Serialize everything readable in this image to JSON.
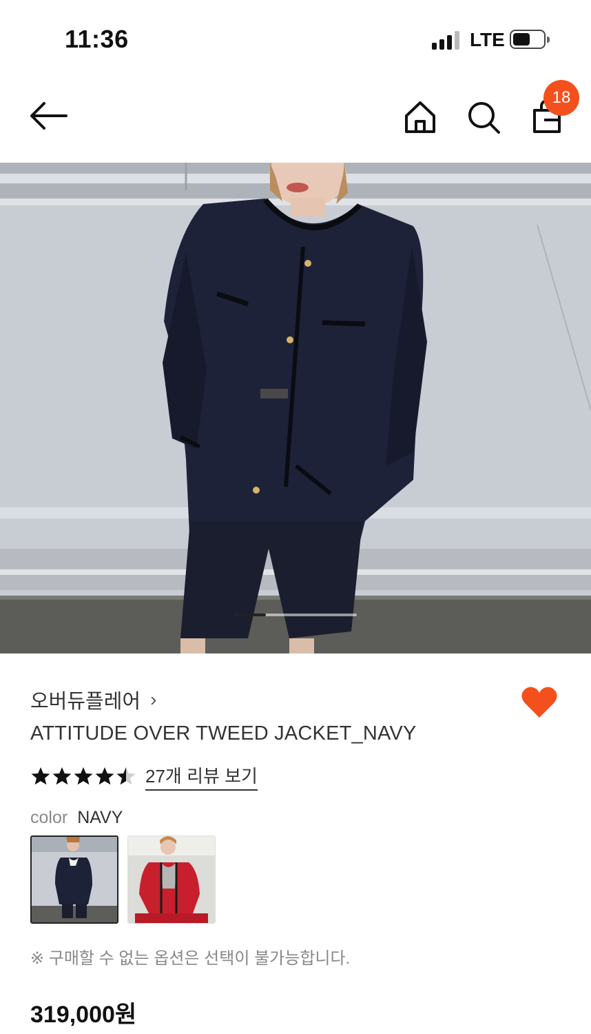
{
  "status_bar": {
    "time": "11:36",
    "network": "LTE"
  },
  "header": {
    "back_icon": "arrow-left-icon",
    "home_icon": "home-icon",
    "search_icon": "search-icon",
    "bag_icon": "shopping-bag-icon",
    "bag_count": "18",
    "badge_color": "#f4501e"
  },
  "gallery": {
    "image": "model wearing navy tweed jacket and shorts",
    "current_slide_fraction": 0.25
  },
  "product": {
    "brand": "오버듀플레어",
    "brand_chevron": "›",
    "name": "ATTITUDE OVER TWEED JACKET_NAVY",
    "wishlisted": true,
    "heart_color": "#f4501e",
    "rating": 4.5,
    "review_link": "27개 리뷰 보기",
    "color_label": "color",
    "color_value": "NAVY",
    "color_options": [
      {
        "name": "NAVY",
        "selected": true
      },
      {
        "name": "RED",
        "selected": false
      }
    ],
    "notice": "※ 구매할 수 없는 옵션은 선택이 불가능합니다.",
    "price": "319,000원"
  }
}
